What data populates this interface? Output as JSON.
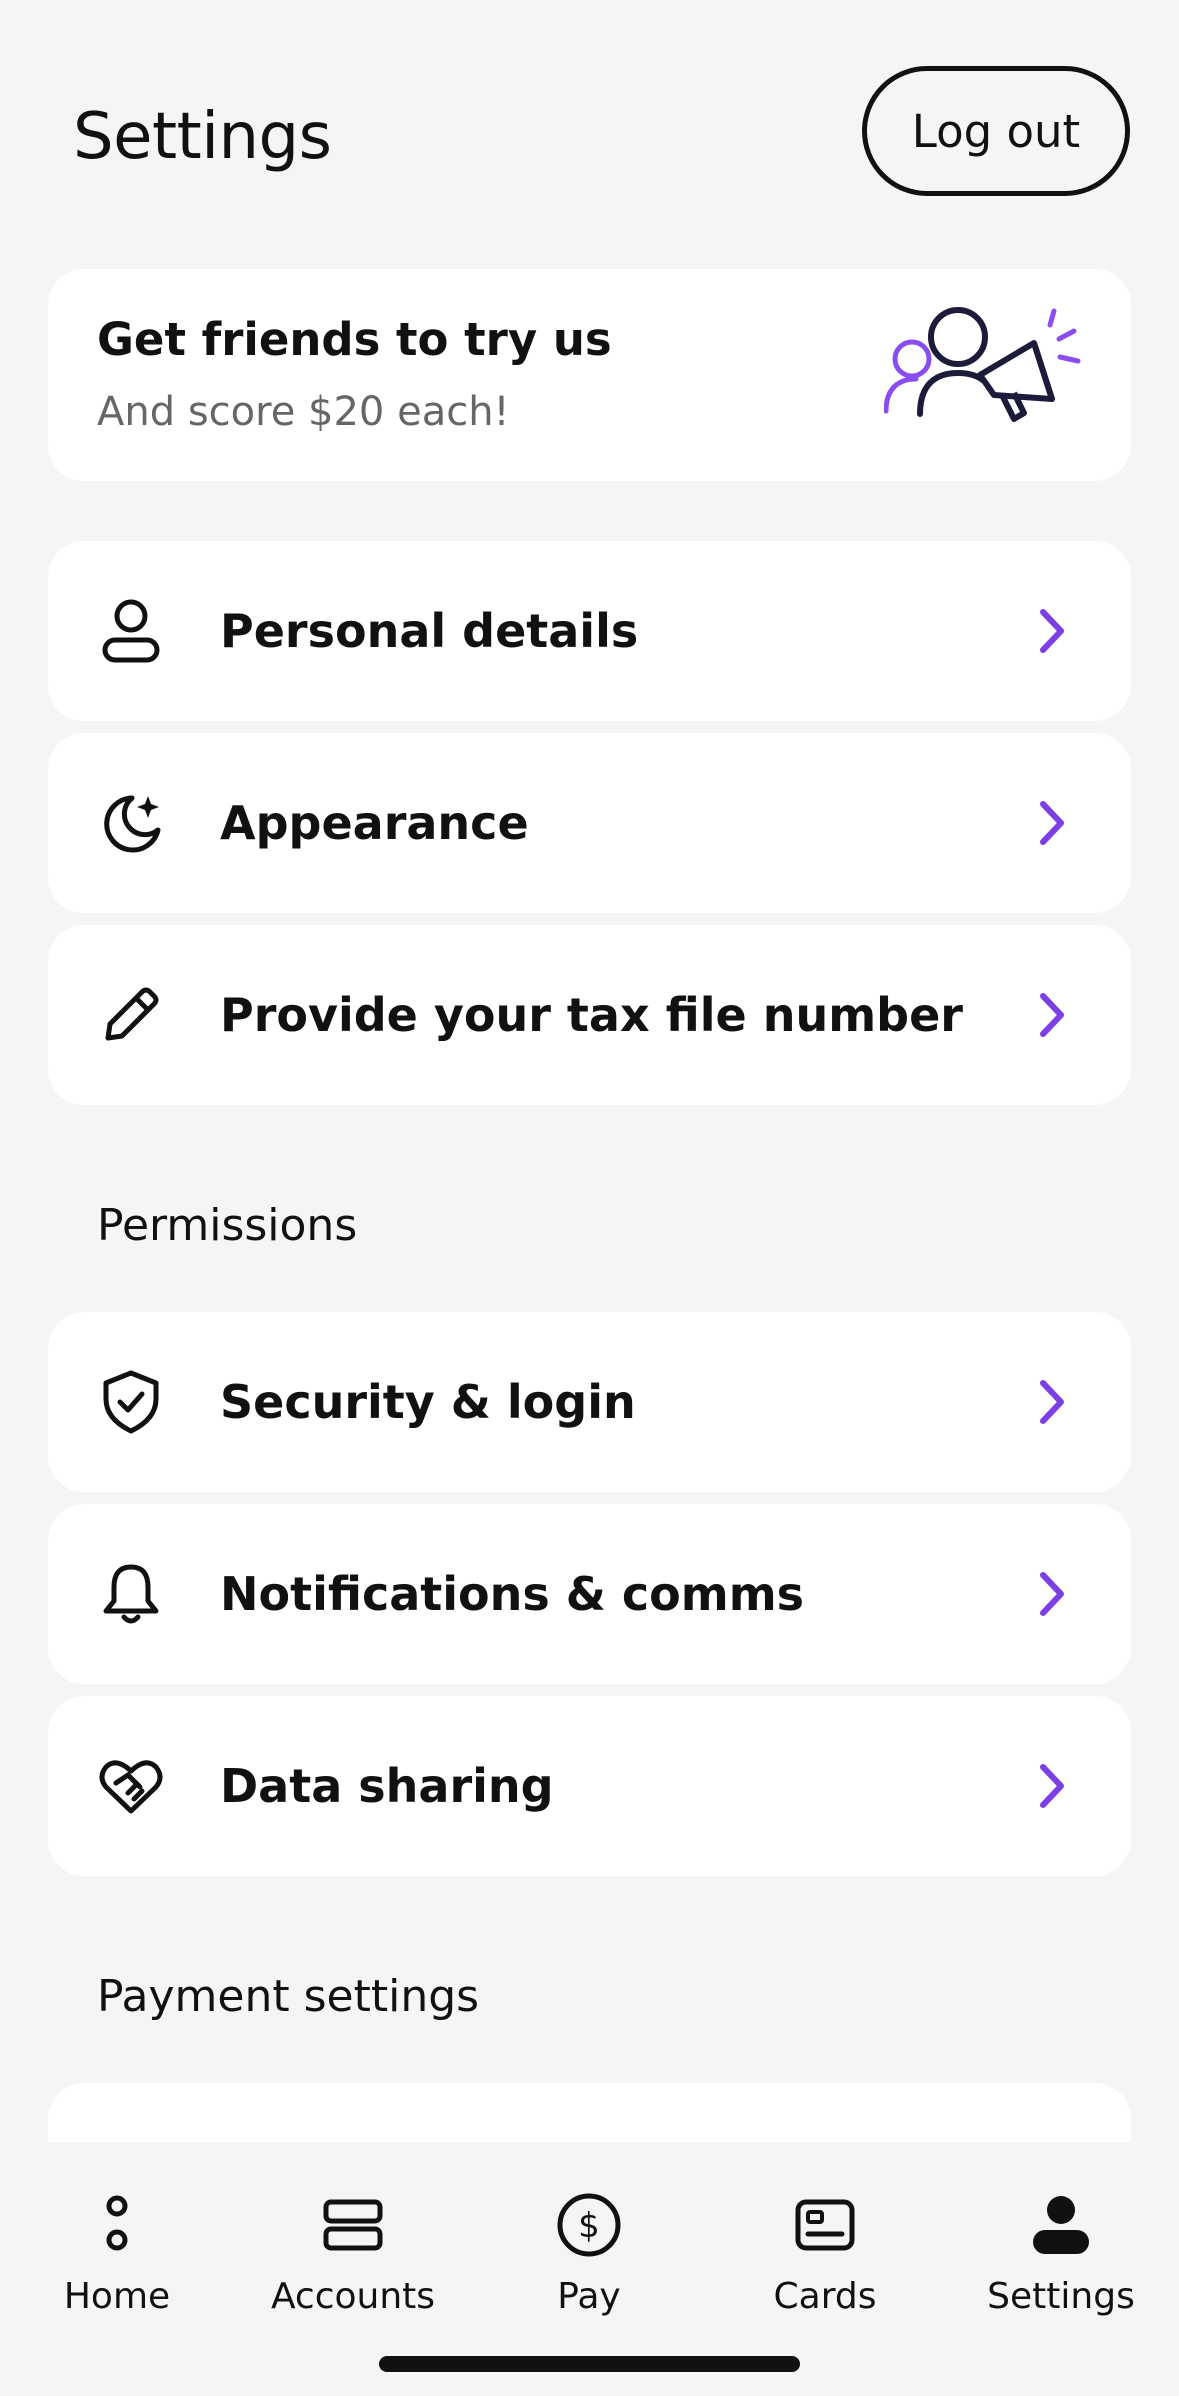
{
  "header": {
    "title": "Settings",
    "logout_label": "Log out"
  },
  "promo": {
    "title": "Get friends to try us",
    "subtitle": "And score $20 each!",
    "icon": "refer-friends-megaphone-icon"
  },
  "profile_items": [
    {
      "label": "Personal details",
      "icon": "person-icon"
    },
    {
      "label": "Appearance",
      "icon": "moon-sparkle-icon"
    },
    {
      "label": "Provide your tax file number",
      "icon": "pencil-icon"
    }
  ],
  "permissions": {
    "heading": "Permissions",
    "items": [
      {
        "label": "Security & login",
        "icon": "shield-check-icon"
      },
      {
        "label": "Notifications & comms",
        "icon": "bell-icon"
      },
      {
        "label": "Data sharing",
        "icon": "heart-handshake-icon"
      }
    ]
  },
  "payment_settings": {
    "heading": "Payment settings"
  },
  "tabbar": {
    "tabs": [
      {
        "label": "Home",
        "icon": "home-dots-icon"
      },
      {
        "label": "Accounts",
        "icon": "accounts-icon"
      },
      {
        "label": "Pay",
        "icon": "dollar-circle-icon"
      },
      {
        "label": "Cards",
        "icon": "card-icon"
      },
      {
        "label": "Settings",
        "icon": "person-filled-icon",
        "active": true
      }
    ]
  },
  "colors": {
    "accent": "#7b3fe4",
    "background": "#f5f5f5",
    "card": "#ffffff",
    "text": "#111111"
  }
}
